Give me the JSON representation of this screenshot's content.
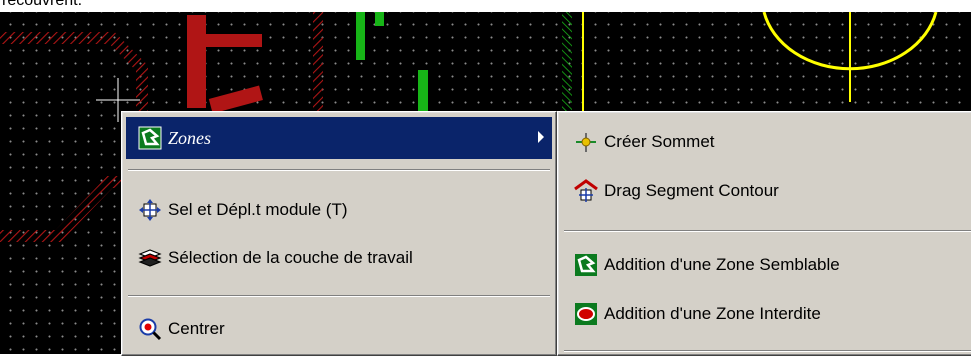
{
  "caption": {
    "text": "recouvrent."
  },
  "context_menu": {
    "items": [
      {
        "label": "Zones",
        "icon": "zone-icon",
        "active": true,
        "has_submenu": true
      },
      {
        "label": "Sel et Dépl.t module (T)",
        "icon": "move-module-icon"
      },
      {
        "label": "Sélection de la couche de travail",
        "icon": "layers-icon"
      },
      {
        "label": "Centrer",
        "icon": "center-zoom-icon"
      }
    ]
  },
  "submenu": {
    "items": [
      {
        "label": "Créer Sommet",
        "icon": "add-corner-icon"
      },
      {
        "label": "Drag Segment Contour",
        "icon": "drag-segment-icon"
      },
      {
        "label": "Addition d'une Zone Semblable",
        "icon": "add-similar-zone-icon"
      },
      {
        "label": "Addition d'une Zone Interdite",
        "icon": "add-forbidden-zone-icon"
      }
    ]
  },
  "colors": {
    "menu_bg": "#d4d0c8",
    "highlight": "#0a246a",
    "canvas_bg": "#000000",
    "track_red": "#b01515",
    "track_green": "#17b517",
    "pad_yellow": "#ffff00"
  }
}
